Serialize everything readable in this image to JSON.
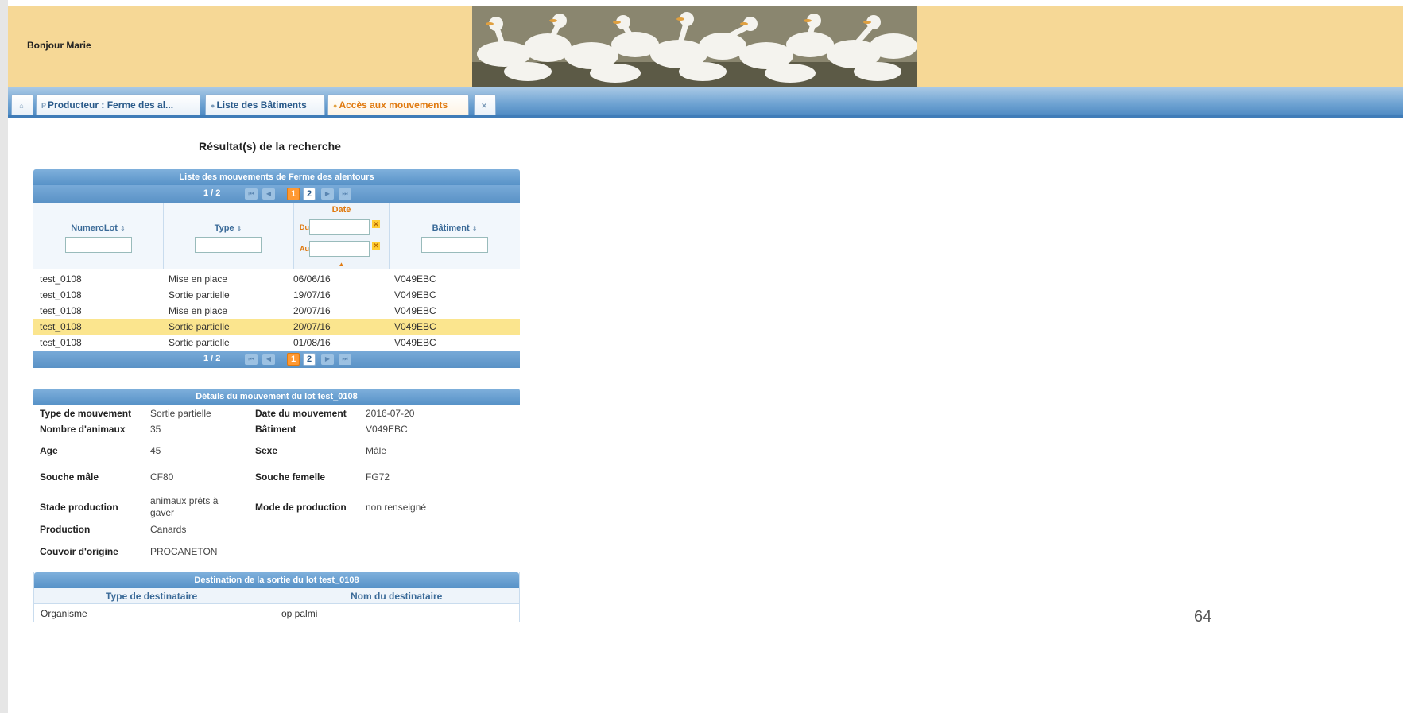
{
  "header": {
    "greeting": "Bonjour Marie",
    "banner_alt": "ducks-banner"
  },
  "tabs": [
    {
      "label": "",
      "icon": "home-icon"
    },
    {
      "label": "Producteur : Ferme des al...",
      "icon": "person-icon"
    },
    {
      "label": "Liste des Bâtiments",
      "icon": "dot-icon"
    },
    {
      "label": "Accès aux mouvements",
      "icon": "dot-icon",
      "active": true
    },
    {
      "label": "",
      "icon": "close-icon"
    }
  ],
  "results_title": "Résultat(s) de la recherche",
  "movements": {
    "title": "Liste des mouvements de Ferme des alentours",
    "pager": {
      "count": "1 / 2",
      "pages": [
        "1",
        "2"
      ],
      "current": "1"
    },
    "columns": {
      "numero": "NumeroLot",
      "type": "Type",
      "date": "Date",
      "date_from": "Du",
      "date_to": "Au",
      "batiment": "Bâtiment"
    },
    "rows": [
      {
        "lot": "test_0108",
        "type": "Mise en place",
        "date": "06/06/16",
        "batiment": "V049EBC"
      },
      {
        "lot": "test_0108",
        "type": "Sortie partielle",
        "date": "19/07/16",
        "batiment": "V049EBC"
      },
      {
        "lot": "test_0108",
        "type": "Mise en place",
        "date": "20/07/16",
        "batiment": "V049EBC"
      },
      {
        "lot": "test_0108",
        "type": "Sortie partielle",
        "date": "20/07/16",
        "batiment": "V049EBC",
        "selected": true
      },
      {
        "lot": "test_0108",
        "type": "Sortie partielle",
        "date": "01/08/16",
        "batiment": "V049EBC"
      }
    ]
  },
  "details": {
    "title": "Détails du mouvement du lot test_0108",
    "type_mouvement_label": "Type de mouvement",
    "type_mouvement": "Sortie partielle",
    "date_mouvement_label": "Date du mouvement",
    "date_mouvement": "2016-07-20",
    "nombre_animaux_label": "Nombre d'animaux",
    "nombre_animaux": "35",
    "batiment_label": "Bâtiment",
    "batiment": "V049EBC",
    "age_label": "Age",
    "age": "45",
    "sexe_label": "Sexe",
    "sexe": "Mâle",
    "souche_male_label": "Souche mâle",
    "souche_male": "CF80",
    "souche_femelle_label": "Souche femelle",
    "souche_femelle": "FG72",
    "stade_production_label": "Stade production",
    "stade_production_1": "animaux prêts à",
    "stade_production_2": "gaver",
    "mode_production_label": "Mode de production",
    "mode_production": "non renseigné",
    "production_label": "Production",
    "production": "Canards",
    "couvoir_label": "Couvoir d'origine",
    "couvoir": "PROCANETON"
  },
  "destination": {
    "title": "Destination de la sortie du lot test_0108",
    "col_type": "Type de destinataire",
    "col_nom": "Nom du destinataire",
    "rows": [
      {
        "type": "Organisme",
        "nom": "op palmi"
      }
    ]
  },
  "page_number": "64",
  "colors": {
    "header_bg": "#f6d896",
    "tab_active": "#e07a10",
    "panel_blue": "#5792c8",
    "selected_row": "#fbe58e"
  }
}
